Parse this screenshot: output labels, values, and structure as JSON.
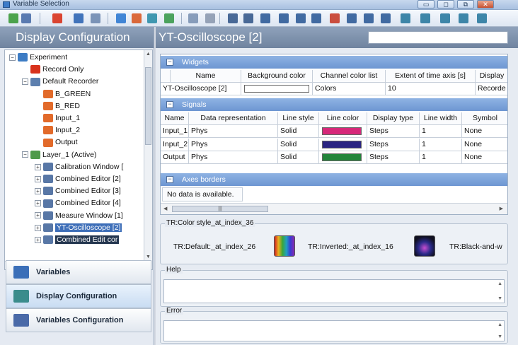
{
  "window": {
    "title": "Variable Selection",
    "buttons": [
      "▭",
      "◻",
      "⧉",
      "✕"
    ]
  },
  "toolbar": {
    "icons": [
      {
        "name": "new-icon",
        "color": "#3a9a3a"
      },
      {
        "name": "dropdown-icon",
        "color": "#4a6ea8"
      },
      {
        "name": "delete-icon",
        "color": "#d8321c"
      },
      {
        "name": "minimize-icon",
        "color": "#2f66b4"
      },
      {
        "name": "window-icon",
        "color": "#6f8ab0"
      },
      {
        "name": "blue-sphere-icon",
        "color": "#2f7ad1"
      },
      {
        "name": "red-square-icon",
        "color": "#d85a26"
      },
      {
        "name": "globe-icon",
        "color": "#2c8ea8"
      },
      {
        "name": "green-house-icon",
        "color": "#3a9a4c"
      },
      {
        "name": "window-2-icon",
        "color": "#7c93b4"
      },
      {
        "name": "grid-icon",
        "color": "#8c9ab0"
      },
      {
        "name": "probe-icon",
        "color": "#365a8c"
      },
      {
        "name": "probe-2-icon",
        "color": "#365a8c"
      },
      {
        "name": "bracket-icon",
        "color": "#2f5c98"
      },
      {
        "name": "bracket-2-icon",
        "color": "#2f5c98"
      },
      {
        "name": "chart-icon",
        "color": "#2f5c98"
      },
      {
        "name": "chart-2-icon",
        "color": "#2f5c98"
      },
      {
        "name": "arrows-icon",
        "color": "#c73c2a"
      },
      {
        "name": "filter-icon",
        "color": "#2f5c98"
      },
      {
        "name": "chart-3-icon",
        "color": "#2f5c98"
      },
      {
        "name": "chart-4-icon",
        "color": "#2f5c98"
      },
      {
        "name": "panel-icon",
        "color": "#2a7aa0"
      },
      {
        "name": "panel-2-icon",
        "color": "#2a7aa0"
      },
      {
        "name": "panel-3-icon",
        "color": "#2a7aa0"
      },
      {
        "name": "panel-4-icon",
        "color": "#2a7aa0"
      },
      {
        "name": "panel-5-icon",
        "color": "#2a7aa0"
      }
    ]
  },
  "left": {
    "header": "Display Configuration",
    "tree": [
      {
        "label": "Experiment",
        "depth": 0,
        "expander": "-",
        "icon": "experiment-icon",
        "color": "#3d7cc4"
      },
      {
        "label": "Record Only",
        "depth": 1,
        "expander": "",
        "icon": "record-icon",
        "color": "#d8321c"
      },
      {
        "label": "Default Recorder",
        "depth": 1,
        "expander": "-",
        "icon": "recorder-icon",
        "color": "#5d7fae"
      },
      {
        "label": "B_GREEN",
        "depth": 2,
        "expander": "",
        "icon": "variable-icon",
        "color": "#e26a2a"
      },
      {
        "label": "B_RED",
        "depth": 2,
        "expander": "",
        "icon": "variable-icon",
        "color": "#e26a2a"
      },
      {
        "label": "Input_1",
        "depth": 2,
        "expander": "",
        "icon": "variable-icon",
        "color": "#e26a2a"
      },
      {
        "label": "Input_2",
        "depth": 2,
        "expander": "",
        "icon": "variable-icon",
        "color": "#e26a2a"
      },
      {
        "label": "Output",
        "depth": 2,
        "expander": "",
        "icon": "variable-icon",
        "color": "#e26a2a"
      },
      {
        "label": "Layer_1 (Active)",
        "depth": 1,
        "expander": "-",
        "icon": "layer-icon",
        "color": "#4f9a4a"
      },
      {
        "label": "Calibration Window [",
        "depth": 2,
        "expander": "+",
        "icon": "window-icon",
        "color": "#5877a6"
      },
      {
        "label": "Combined Editor [2]",
        "depth": 2,
        "expander": "+",
        "icon": "window-icon",
        "color": "#5877a6"
      },
      {
        "label": "Combined Editor [3]",
        "depth": 2,
        "expander": "+",
        "icon": "window-icon",
        "color": "#5877a6"
      },
      {
        "label": "Combined Editor [4]",
        "depth": 2,
        "expander": "+",
        "icon": "window-icon",
        "color": "#5877a6"
      },
      {
        "label": "Measure Window [1]",
        "depth": 2,
        "expander": "+",
        "icon": "window-icon",
        "color": "#5877a6"
      },
      {
        "label": "YT-Oscilloscope [2]",
        "depth": 2,
        "expander": "+",
        "icon": "window-icon",
        "color": "#5877a6",
        "state": "selected"
      },
      {
        "label": "Combined Edit cor",
        "depth": 2,
        "expander": "+",
        "icon": "window-icon",
        "color": "#5877a6",
        "state": "highlight"
      }
    ],
    "nav": [
      {
        "label": "Variables",
        "icon": "variables-icon",
        "color": "#3b6fb8",
        "active": false
      },
      {
        "label": "Display Configuration",
        "icon": "display-configuration-icon",
        "color": "#3a8c8c",
        "active": true
      },
      {
        "label": "Variables Configuration",
        "icon": "variables-configuration-icon",
        "color": "#4a6aa8",
        "active": false
      }
    ]
  },
  "right": {
    "header": "YT-Oscilloscope [2]",
    "widgets": {
      "title": "Widgets",
      "columns": [
        "Name",
        "Background color",
        "Channel color list",
        "Extent of time axis [s]",
        "Display"
      ],
      "row": [
        "YT-Oscilloscope [2]",
        "",
        "Colors",
        "10",
        "Recorde"
      ]
    },
    "signals": {
      "title": "Signals",
      "columns": [
        "Name",
        "Data representation",
        "Line style",
        "Line color",
        "Display type",
        "Line width",
        "Symbol"
      ],
      "rows": [
        {
          "cells": [
            "Input_1",
            "Phys",
            "Solid",
            "",
            "Steps",
            "1",
            "None"
          ],
          "color": "#d6287a"
        },
        {
          "cells": [
            "Input_2",
            "Phys",
            "Solid",
            "",
            "Steps",
            "1",
            "None"
          ],
          "color": "#2a2482"
        },
        {
          "cells": [
            "Output",
            "Phys",
            "Solid",
            "",
            "Steps",
            "1",
            "None"
          ],
          "color": "#22843a"
        }
      ]
    },
    "axes": {
      "title": "Axes borders",
      "empty": "No data is available."
    },
    "color_style": {
      "legend": "TR:Color style_at_index_36",
      "options": [
        {
          "label": "TR:Default:_at_index_26",
          "icon": "rainbow-palette-icon"
        },
        {
          "label": "TR:Inverted:_at_index_16",
          "icon": "inverted-palette-icon"
        },
        {
          "label": "TR:Black-and-w",
          "icon": ""
        }
      ]
    },
    "help": {
      "legend": "Help"
    },
    "error": {
      "legend": "Error"
    }
  }
}
